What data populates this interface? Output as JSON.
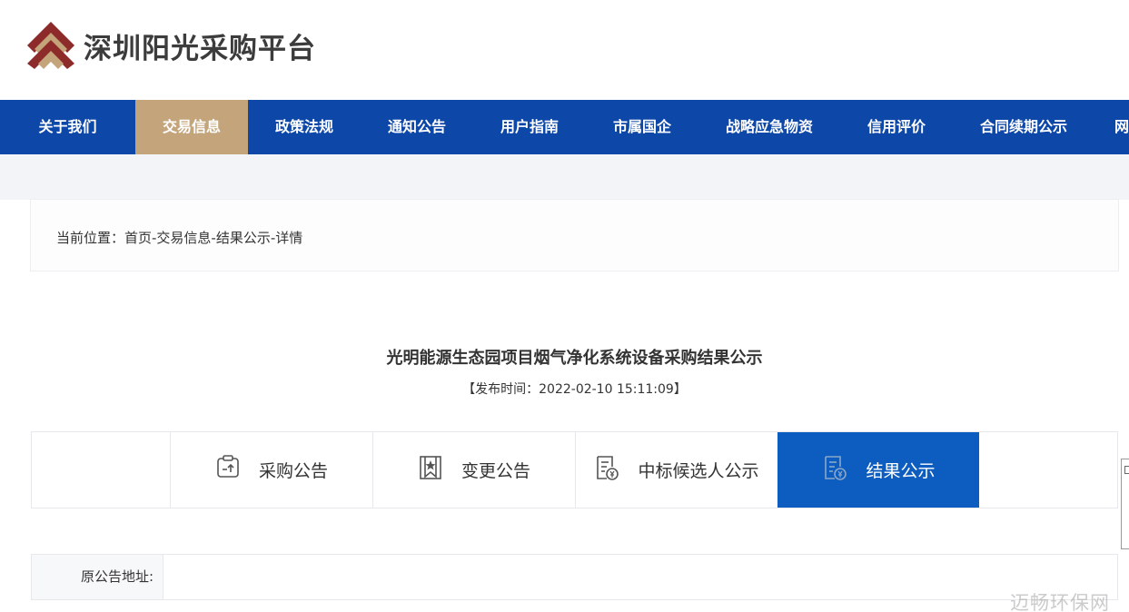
{
  "header": {
    "site_name": "深圳阳光采购平台"
  },
  "nav": {
    "items": [
      {
        "label": "关于我们",
        "active": false
      },
      {
        "label": "交易信息",
        "active": true
      },
      {
        "label": "政策法规",
        "active": false
      },
      {
        "label": "通知公告",
        "active": false
      },
      {
        "label": "用户指南",
        "active": false
      },
      {
        "label": "市属国企",
        "active": false
      },
      {
        "label": "战略应急物资",
        "active": false
      },
      {
        "label": "信用评价",
        "active": false
      },
      {
        "label": "合同续期公示",
        "active": false
      },
      {
        "label": "网",
        "active": false
      }
    ]
  },
  "breadcrumb": {
    "text": "当前位置：首页-交易信息-结果公示-详情"
  },
  "article": {
    "title": "光明能源生态园项目烟气净化系统设备采购结果公示",
    "publish_time": "【发布时间：2022-02-10 15:11:09】"
  },
  "tabs": [
    {
      "label": "采购公告",
      "icon": "clipboard-upload-icon",
      "active": false
    },
    {
      "label": "变更公告",
      "icon": "bookmark-star-icon",
      "active": false
    },
    {
      "label": "中标候选人公示",
      "icon": "document-yen-icon",
      "active": false
    },
    {
      "label": "结果公示",
      "icon": "document-yen-icon",
      "active": true
    }
  ],
  "detail": {
    "original_address_label": "原公告地址:",
    "original_address_value": ""
  },
  "watermark": "迈畅环保网",
  "colors": {
    "nav_bg": "#0d47a8",
    "nav_active": "#c4a47a",
    "tab_active": "#0d5cbf"
  }
}
